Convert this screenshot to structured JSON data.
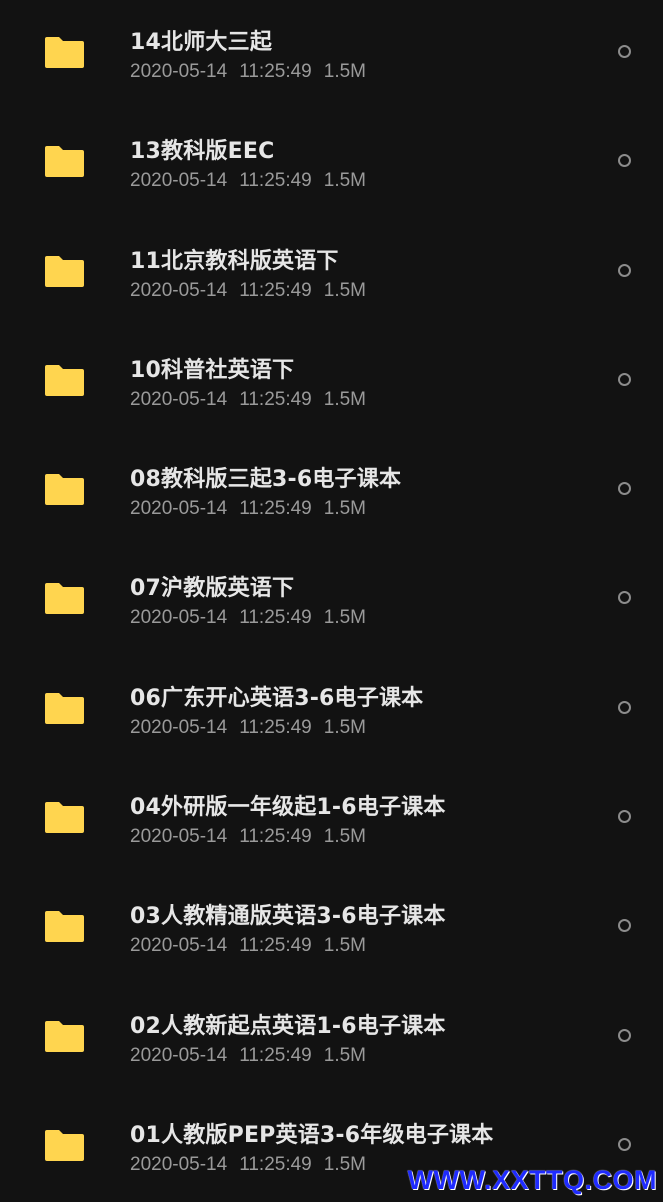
{
  "colors": {
    "background": "#121212",
    "folder": "#FFD54F",
    "name_text": "#e6e6e6",
    "meta_text": "#9a9a9a",
    "watermark": "#1f2bff"
  },
  "icons": {
    "folder": "folder-icon",
    "radio": "radio-unchecked-icon"
  },
  "files": [
    {
      "name": "14北师大三起",
      "date": "2020-05-14",
      "time": "11:25:49",
      "size": "1.5M"
    },
    {
      "name": "13教科版EEC",
      "date": "2020-05-14",
      "time": "11:25:49",
      "size": "1.5M"
    },
    {
      "name": "11北京教科版英语下",
      "date": "2020-05-14",
      "time": "11:25:49",
      "size": "1.5M"
    },
    {
      "name": "10科普社英语下",
      "date": "2020-05-14",
      "time": "11:25:49",
      "size": "1.5M"
    },
    {
      "name": "08教科版三起3-6电子课本",
      "date": "2020-05-14",
      "time": "11:25:49",
      "size": "1.5M"
    },
    {
      "name": "07沪教版英语下",
      "date": "2020-05-14",
      "time": "11:25:49",
      "size": "1.5M"
    },
    {
      "name": "06广东开心英语3-6电子课本",
      "date": "2020-05-14",
      "time": "11:25:49",
      "size": "1.5M"
    },
    {
      "name": "04外研版一年级起1-6电子课本",
      "date": "2020-05-14",
      "time": "11:25:49",
      "size": "1.5M"
    },
    {
      "name": "03人教精通版英语3-6电子课本",
      "date": "2020-05-14",
      "time": "11:25:49",
      "size": "1.5M"
    },
    {
      "name": "02人教新起点英语1-6电子课本",
      "date": "2020-05-14",
      "time": "11:25:49",
      "size": "1.5M"
    },
    {
      "name": "01人教版PEP英语3-6年级电子课本",
      "date": "2020-05-14",
      "time": "11:25:49",
      "size": "1.5M"
    }
  ],
  "watermark": {
    "text": "WWW.XXTTQ.COM"
  }
}
